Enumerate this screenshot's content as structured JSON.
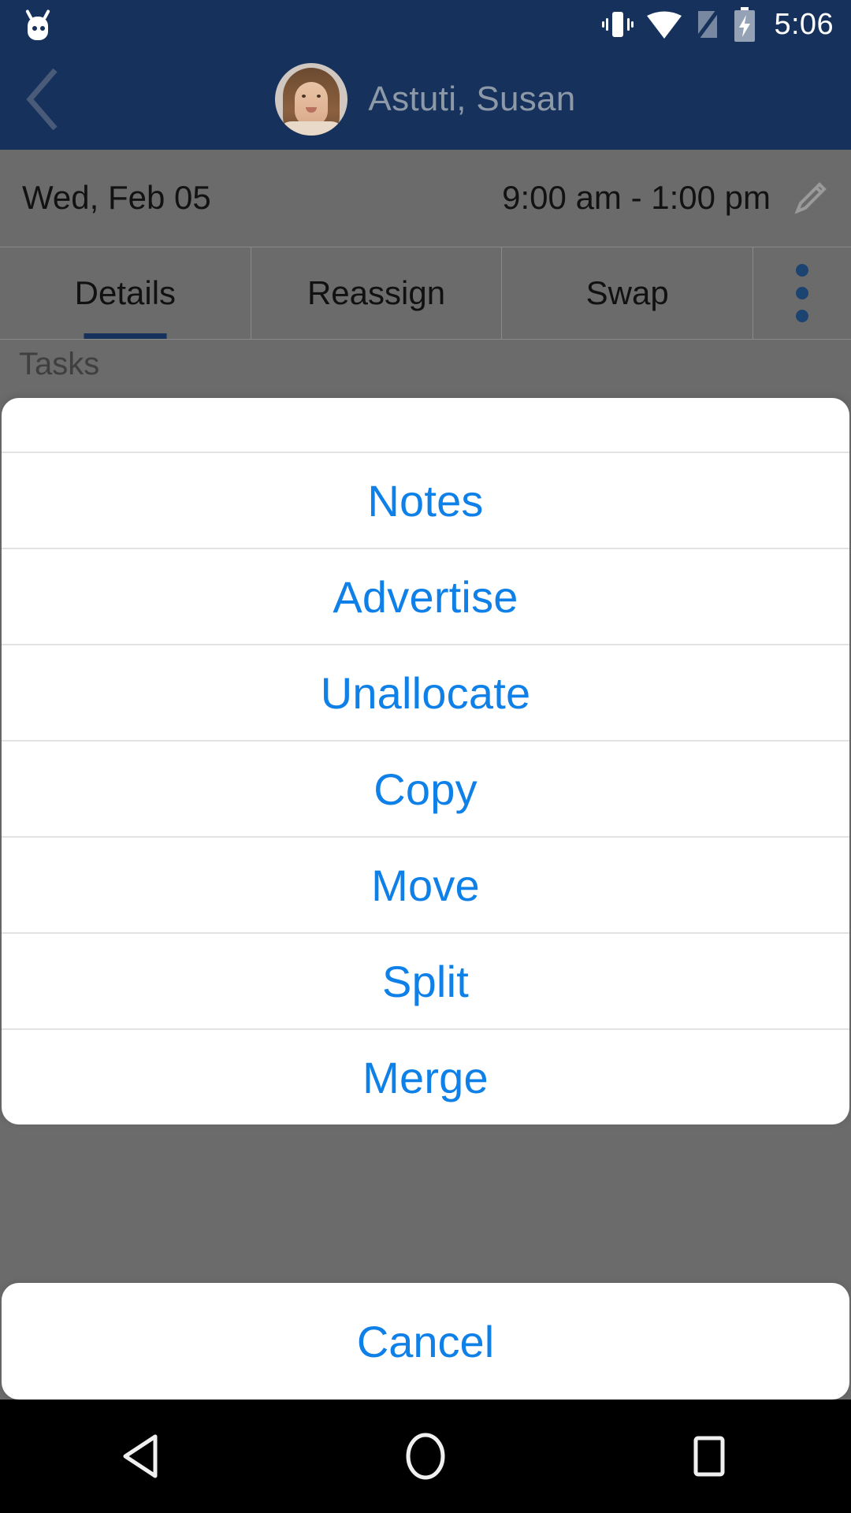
{
  "status_bar": {
    "time": "5:06",
    "icons": [
      "cyanogenmod-robot-icon",
      "vibrate-icon",
      "wifi-icon",
      "signal-off-icon",
      "battery-charging-icon"
    ]
  },
  "header": {
    "back_label": "back-chevron-icon",
    "title": "Astuti, Susan",
    "avatar_label": "avatar"
  },
  "shift": {
    "date": "Wed, Feb 05",
    "time_range": "9:00 am - 1:00 pm",
    "edit_label": "edit-pencil-icon"
  },
  "tabs": {
    "items": [
      {
        "label": "Details",
        "active": true
      },
      {
        "label": "Reassign",
        "active": false
      },
      {
        "label": "Swap",
        "active": false
      }
    ],
    "overflow_label": "overflow-menu-icon"
  },
  "content": {
    "section_label": "Tasks"
  },
  "action_sheet": {
    "items": [
      {
        "label": "Notes"
      },
      {
        "label": "Advertise"
      },
      {
        "label": "Unallocate"
      },
      {
        "label": "Copy"
      },
      {
        "label": "Move"
      },
      {
        "label": "Split"
      },
      {
        "label": "Merge"
      }
    ],
    "cancel_label": "Cancel"
  },
  "nav_bar": {
    "back": "back-triangle-icon",
    "home": "home-circle-icon",
    "recents": "recents-square-icon"
  },
  "colors": {
    "header_navy": "#16325c",
    "action_blue": "#0e80e8",
    "scrim_gray": "#6b6b6b",
    "tab_indicator": "#16325c"
  }
}
